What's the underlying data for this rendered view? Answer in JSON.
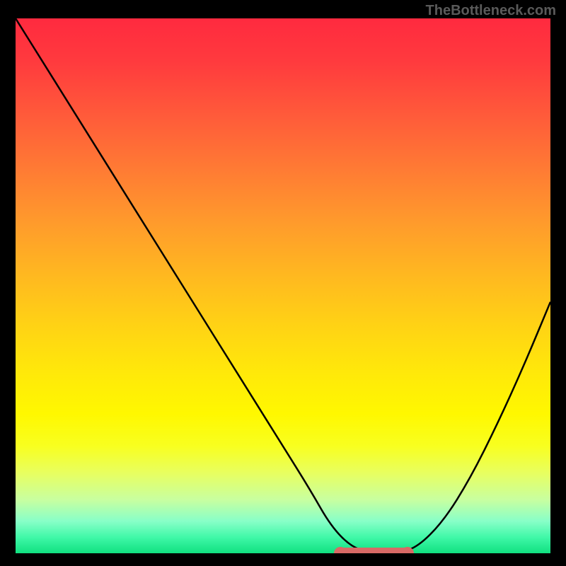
{
  "watermark": "TheBottleneck.com",
  "chart_data": {
    "type": "line",
    "title": "",
    "xlabel": "",
    "ylabel": "",
    "xlim": [
      0,
      100
    ],
    "ylim": [
      0,
      100
    ],
    "x": [
      0,
      5,
      10,
      15,
      20,
      25,
      30,
      35,
      40,
      45,
      50,
      55,
      59,
      63,
      67,
      71,
      75,
      80,
      85,
      90,
      95,
      100
    ],
    "values": [
      100,
      92,
      84,
      76,
      68,
      60,
      52,
      44,
      36,
      28,
      20,
      12,
      5,
      1,
      0,
      0,
      1,
      6,
      14,
      24,
      35,
      47
    ],
    "optimal_range": {
      "start": 60,
      "end": 74,
      "value": 0
    },
    "background_gradient": {
      "top_color": "#ff2a3f",
      "mid_color": "#ffe80a",
      "bottom_color": "#10e080"
    },
    "marker_color": "#d86a66"
  }
}
